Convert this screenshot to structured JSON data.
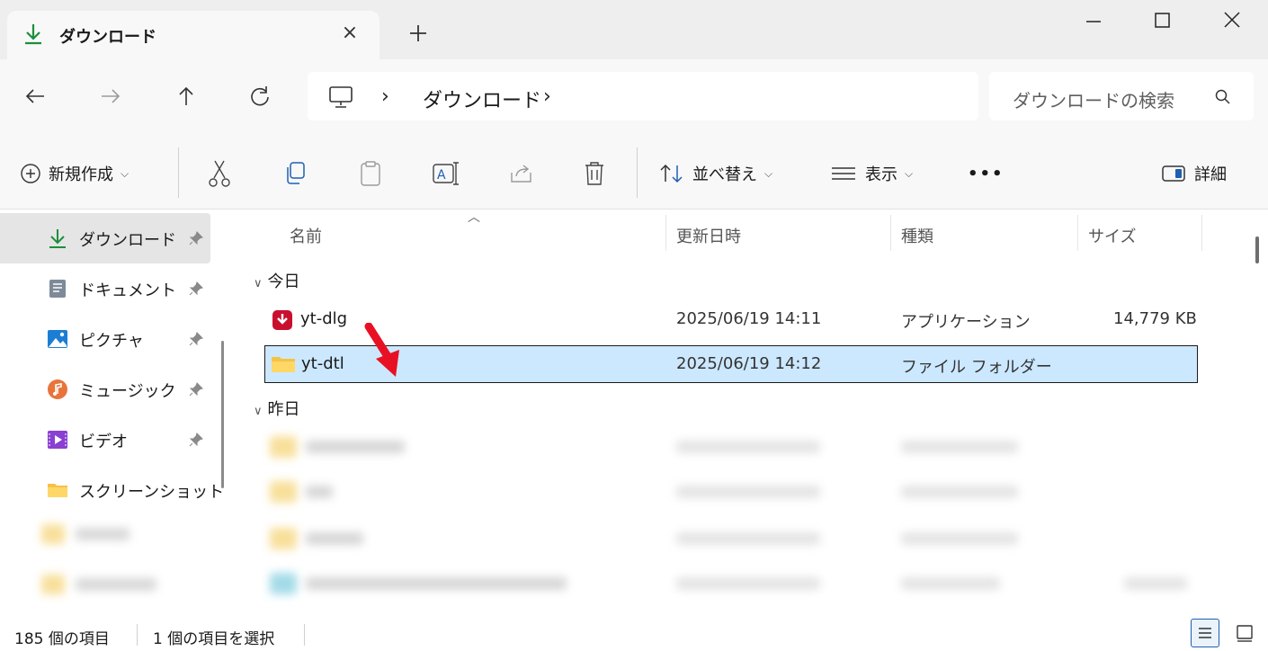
{
  "tab": {
    "title": "ダウンロード",
    "close": "×",
    "new_tab": "+"
  },
  "address": {
    "path_folder": "ダウンロード",
    "sep1": "›",
    "sep2": "›"
  },
  "search": {
    "placeholder": "ダウンロードの検索"
  },
  "commands": {
    "new": "新規作成",
    "sort": "並べ替え",
    "view": "表示",
    "more": "•••",
    "details": "詳細"
  },
  "sidebar": {
    "items": [
      {
        "label": "ダウンロード",
        "icon": "download-icon",
        "pinned": true,
        "selected": true
      },
      {
        "label": "ドキュメント",
        "icon": "document-icon",
        "pinned": true
      },
      {
        "label": "ピクチャ",
        "icon": "pictures-icon",
        "pinned": true
      },
      {
        "label": "ミュージック",
        "icon": "music-icon",
        "pinned": true
      },
      {
        "label": "ビデオ",
        "icon": "video-icon",
        "pinned": true
      },
      {
        "label": "スクリーンショット",
        "icon": "folder-icon",
        "pinned": false
      }
    ]
  },
  "columns": {
    "name": "名前",
    "modified": "更新日時",
    "type": "種類",
    "size": "サイズ"
  },
  "groups": {
    "today": "今日",
    "yesterday": "昨日"
  },
  "files": [
    {
      "name": "yt-dlg",
      "modified": "2025/06/19 14:11",
      "type": "アプリケーション",
      "size": "14,779 KB",
      "icon": "app-icon"
    },
    {
      "name": "yt-dtl",
      "modified": "2025/06/19 14:12",
      "type": "ファイル フォルダー",
      "size": "",
      "icon": "folder-icon",
      "selected": true
    }
  ],
  "status": {
    "count": "185 個の項目",
    "selected": "1 個の項目を選択"
  },
  "colors": {
    "accent": "#0067c0",
    "selection": "#cce8ff",
    "folder": "#f5c344",
    "arrow": "#e81123"
  }
}
